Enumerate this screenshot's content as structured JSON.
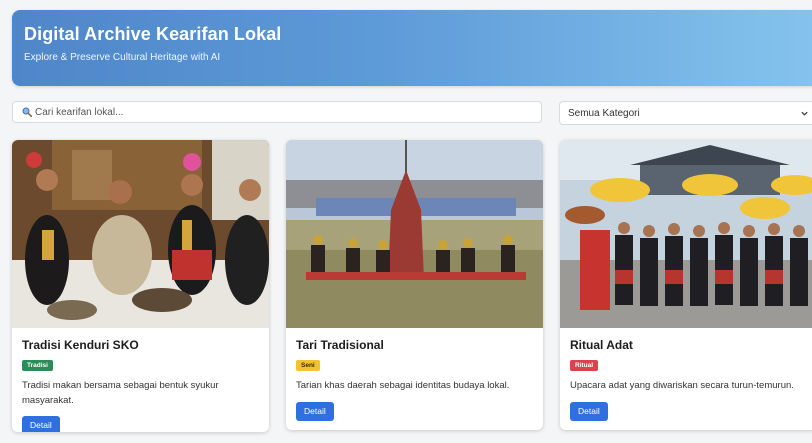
{
  "header": {
    "title": "Digital Archive Kearifan Lokal",
    "subtitle": "Explore & Preserve Cultural Heritage with AI",
    "gradient": [
      "#4f86c9",
      "#86c4ee"
    ]
  },
  "search": {
    "placeholder": "Cari kearifan lokal...",
    "value": "",
    "icon": "search-icon"
  },
  "filter": {
    "selected": "Semua Kategori",
    "icon": "chevron-down-icon"
  },
  "cards": [
    {
      "title": "Tradisi Kenduri SKO",
      "badge": "Tradisi",
      "badge_color": "#2e8b57",
      "description": "Tradisi makan bersama sebagai bentuk syukur masyarakat.",
      "button": "Detail"
    },
    {
      "title": "Tari Tradisional",
      "badge": "Seni",
      "badge_color": "#f2c230",
      "description": "Tarian khas daerah sebagai identitas budaya lokal.",
      "button": "Detail"
    },
    {
      "title": "Ritual Adat",
      "badge": "Ritual",
      "badge_color": "#d9434e",
      "description": "Upacara adat yang diwariskan secara turun-temurun.",
      "button": "Detail"
    }
  ],
  "accent": "#2f6fe0"
}
